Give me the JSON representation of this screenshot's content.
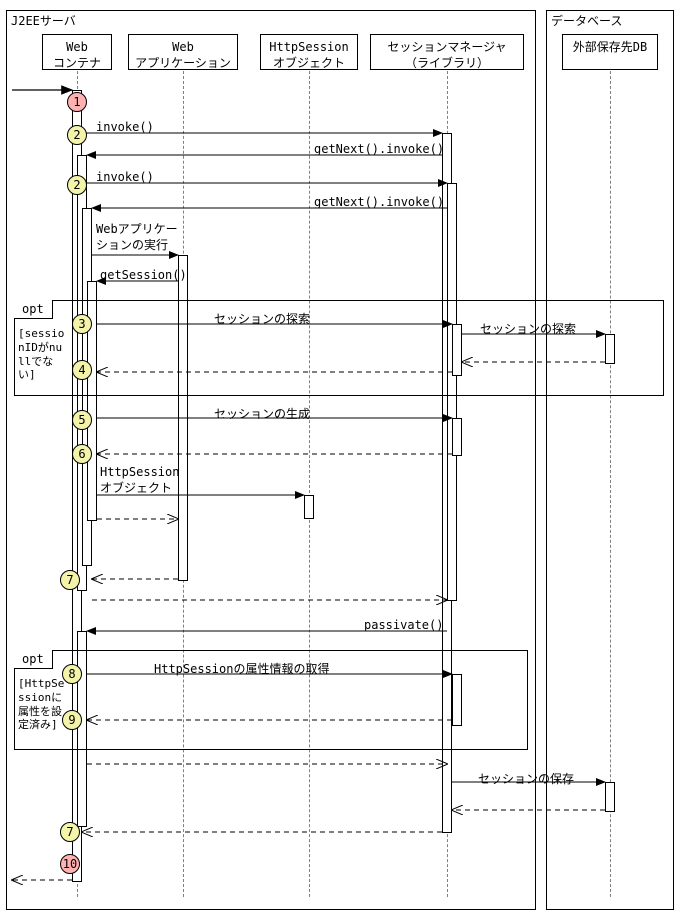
{
  "frames": {
    "j2ee": "J2EEサーバ",
    "db": "データベース"
  },
  "lifelines": {
    "web_container": "Web\nコンテナ",
    "web_app": "Web\nアプリケーション",
    "http_session": "HttpSession\nオブジェクト",
    "session_mgr": "セッションマネージャ\n（ライブラリ）",
    "ext_db": "外部保存先DB"
  },
  "steps": {
    "s1": "1",
    "s2a": "2",
    "s2b": "2",
    "s3": "3",
    "s4": "4",
    "s5": "5",
    "s6": "6",
    "s7a": "7",
    "s7b": "7",
    "s8": "8",
    "s9": "9",
    "s10": "10"
  },
  "messages": {
    "invoke1": "invoke()",
    "getnext1": "getNext().invoke()",
    "invoke2": "invoke()",
    "getnext2": "getNext().invoke()",
    "exec_webapp": "Webアプリケー\nションの実行",
    "get_session": "getSession()",
    "search_session": "セッションの探索",
    "search_session_db": "セッションの探索",
    "create_session": "セッションの生成",
    "httpsession_obj": "HttpSession\nオブジェクト",
    "passivate": "passivate()",
    "get_attrs": "HttpSessionの属性情報の取得",
    "save_session": "セッションの保存"
  },
  "fragments": {
    "opt1_label": "opt",
    "opt1_guard": "[sessionIDがnullでない]",
    "opt2_label": "opt",
    "opt2_guard": "[HttpSessionに属性を設定済み]"
  },
  "chart_data": {
    "type": "sequence_diagram",
    "participants": [
      {
        "id": "web_container",
        "name": "Webコンテナ",
        "group": "J2EEサーバ"
      },
      {
        "id": "web_app",
        "name": "Webアプリケーション",
        "group": "J2EEサーバ"
      },
      {
        "id": "http_session",
        "name": "HttpSessionオブジェクト",
        "group": "J2EEサーバ"
      },
      {
        "id": "session_mgr",
        "name": "セッションマネージャ（ライブラリ）",
        "group": "J2EEサーバ"
      },
      {
        "id": "ext_db",
        "name": "外部保存先DB",
        "group": "データベース"
      }
    ],
    "entry": {
      "to": "web_container",
      "step": 1
    },
    "messages": [
      {
        "step": 2,
        "from": "web_container",
        "to": "session_mgr",
        "label": "invoke()",
        "kind": "call"
      },
      {
        "from": "session_mgr",
        "to": "web_container",
        "label": "getNext().invoke()",
        "kind": "call"
      },
      {
        "step": 2,
        "from": "web_container",
        "to": "session_mgr",
        "label": "invoke()",
        "kind": "call"
      },
      {
        "from": "session_mgr",
        "to": "web_container",
        "label": "getNext().invoke()",
        "kind": "call"
      },
      {
        "from": "web_container",
        "to": "web_app",
        "label": "Webアプリケーションの実行",
        "kind": "call"
      },
      {
        "from": "web_app",
        "to": "web_container",
        "label": "getSession()",
        "kind": "call"
      },
      {
        "fragment": "opt",
        "guard": "sessionIDがnullでない",
        "contains": [
          {
            "step": 3,
            "from": "web_container",
            "to": "session_mgr",
            "label": "セッションの探索",
            "kind": "call"
          },
          {
            "from": "session_mgr",
            "to": "ext_db",
            "label": "セッションの探索",
            "kind": "call"
          },
          {
            "from": "ext_db",
            "to": "session_mgr",
            "kind": "return"
          },
          {
            "step": 4,
            "from": "session_mgr",
            "to": "web_container",
            "kind": "return"
          }
        ]
      },
      {
        "step": 5,
        "from": "web_container",
        "to": "session_mgr",
        "label": "セッションの生成",
        "kind": "call"
      },
      {
        "step": 6,
        "from": "session_mgr",
        "to": "web_container",
        "kind": "return"
      },
      {
        "from": "web_container",
        "to": "http_session",
        "label": "HttpSessionオブジェクト",
        "kind": "create"
      },
      {
        "from": "web_container",
        "to": "web_app",
        "kind": "return"
      },
      {
        "step": 7,
        "from": "web_app",
        "to": "web_container",
        "kind": "return"
      },
      {
        "from": "web_container",
        "to": "session_mgr",
        "kind": "return"
      },
      {
        "from": "session_mgr",
        "to": "web_container",
        "label": "passivate()",
        "kind": "call"
      },
      {
        "fragment": "opt",
        "guard": "HttpSessionに属性を設定済み",
        "contains": [
          {
            "step": 8,
            "from": "web_container",
            "to": "session_mgr",
            "label": "HttpSessionの属性情報の取得",
            "kind": "call"
          },
          {
            "step": 9,
            "from": "session_mgr",
            "to": "web_container",
            "kind": "return"
          }
        ]
      },
      {
        "from": "web_container",
        "to": "session_mgr",
        "kind": "return"
      },
      {
        "from": "session_mgr",
        "to": "ext_db",
        "label": "セッションの保存",
        "kind": "call"
      },
      {
        "from": "ext_db",
        "to": "session_mgr",
        "kind": "return"
      },
      {
        "step": 7,
        "from": "session_mgr",
        "to": "web_container",
        "kind": "return"
      },
      {
        "step": 10,
        "from": "web_container",
        "to": "external",
        "kind": "return"
      }
    ]
  }
}
